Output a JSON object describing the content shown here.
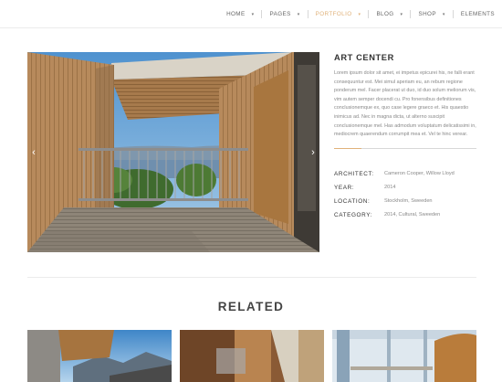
{
  "nav": {
    "items": [
      {
        "label": "HOME",
        "caret": "▾"
      },
      {
        "label": "PAGES",
        "caret": "▾"
      },
      {
        "label": "PORTFOLIO",
        "caret": "▾"
      },
      {
        "label": "BLOG",
        "caret": "▾"
      },
      {
        "label": "SHOP",
        "caret": "▾"
      },
      {
        "label": "ELEMENTS",
        "caret": ""
      }
    ],
    "active": "PORTFOLIO",
    "accent_color": "#e0b27a"
  },
  "slider": {
    "prev_arrow": "‹",
    "next_arrow": "›"
  },
  "project": {
    "title": "ART CENTER",
    "description": "Lorem ipsum dolor sit amet, ei impetus epicurei his, ne falli erant consequuntur est. Mei simul aperiam eu, an rebum regione ponderum mel. Facer placerat ut duo, id duo solum meliorum vis, vim autem semper docendi cu. Pro fonensibus definitiones conclusionemque ex, quo case legere graeco et. His quaestio inimicus ad. Nec in magna dicta, ut alterno suscipit conclusionemque mel. Has admodum voluptatum delicatissimi in, mediocrem quaerendum corrumpit mea et. Vel te hinc verear.",
    "details": [
      {
        "label": "ARCHITECT:",
        "value": "Cameron Cooper, Willow Lloyd"
      },
      {
        "label": "YEAR:",
        "value": "2014"
      },
      {
        "label": "LOCATION:",
        "value": "Stockholm, Sweeden"
      },
      {
        "label": "CATEGORY:",
        "value": "2014, Cultural, Sweeden"
      }
    ]
  },
  "related": {
    "title": "RELATED"
  }
}
